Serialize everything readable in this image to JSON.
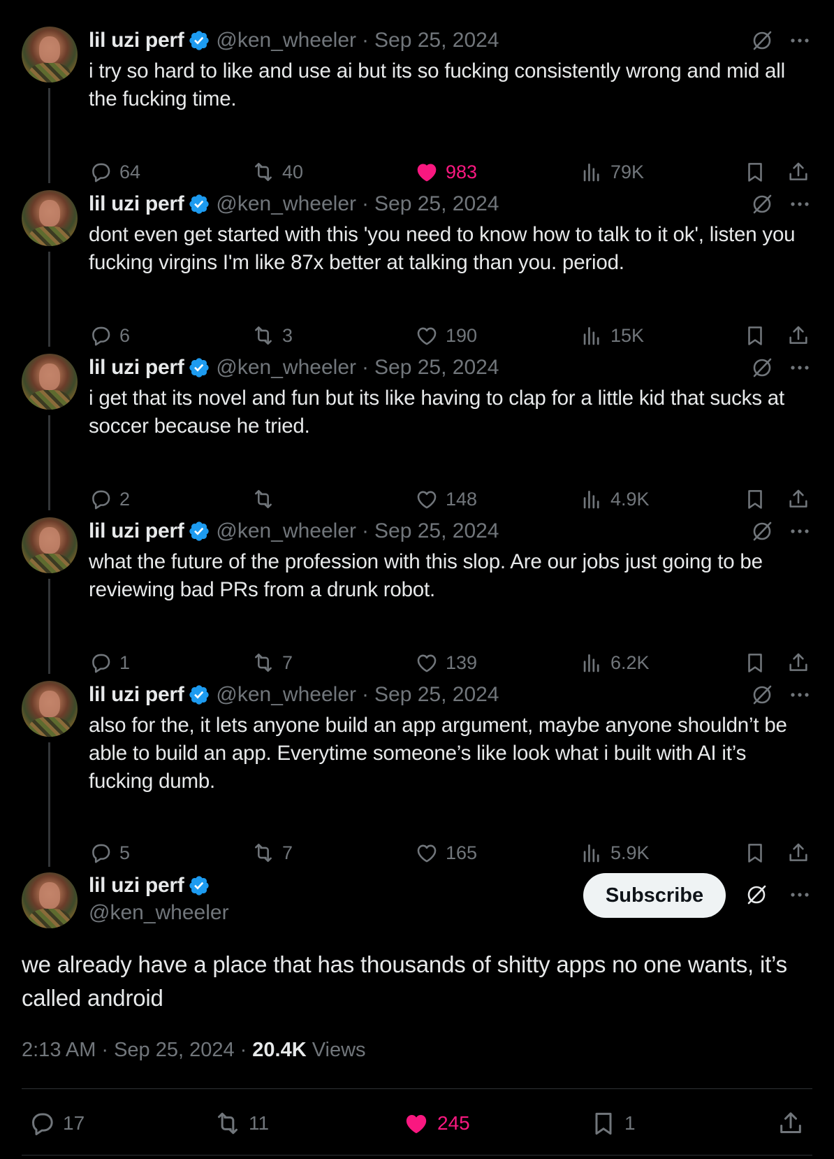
{
  "colors": {
    "background": "#000000",
    "text": "#e7e9ea",
    "muted": "#71767b",
    "verified": "#1d9bf0",
    "like": "#f91880"
  },
  "author": {
    "name": "lil uzi perf",
    "handle": "@ken_wheeler"
  },
  "thread": [
    {
      "name": "lil uzi perf",
      "handle": "@ken_wheeler",
      "sep": "·",
      "date": "Sep 25, 2024",
      "text": "i try so hard to like and use ai but its so fucking consistently wrong and mid all the fucking time.",
      "replies": "64",
      "reposts": "40",
      "likes": "983",
      "liked": true,
      "views": "79K"
    },
    {
      "name": "lil uzi perf",
      "handle": "@ken_wheeler",
      "sep": "·",
      "date": "Sep 25, 2024",
      "text": "dont even get started with this 'you need to know how to talk to it ok', listen you fucking virgins I'm like 87x better at talking than you. period.",
      "replies": "6",
      "reposts": "3",
      "likes": "190",
      "liked": false,
      "views": "15K"
    },
    {
      "name": "lil uzi perf",
      "handle": "@ken_wheeler",
      "sep": "·",
      "date": "Sep 25, 2024",
      "text": "i get that its novel and fun but its like having to clap for a little kid that sucks at soccer because he tried.",
      "replies": "2",
      "reposts": "",
      "likes": "148",
      "liked": false,
      "views": "4.9K"
    },
    {
      "name": "lil uzi perf",
      "handle": "@ken_wheeler",
      "sep": "·",
      "date": "Sep 25, 2024",
      "text": "what the future of the profession with this slop. Are our jobs just going to be reviewing bad PRs from a drunk robot.",
      "replies": "1",
      "reposts": "7",
      "likes": "139",
      "liked": false,
      "views": "6.2K"
    },
    {
      "name": "lil uzi perf",
      "handle": "@ken_wheeler",
      "sep": "·",
      "date": "Sep 25, 2024",
      "text": "also for the, it lets anyone build an app argument, maybe anyone shouldn’t be able to build an app. Everytime someone’s like look what i built with AI it’s fucking dumb.",
      "replies": "5",
      "reposts": "7",
      "likes": "165",
      "liked": false,
      "views": "5.9K"
    }
  ],
  "main": {
    "name": "lil uzi perf",
    "handle": "@ken_wheeler",
    "subscribe_label": "Subscribe",
    "text": "we already have a place that has thousands of shitty apps no one wants, it’s called android",
    "time": "2:13 AM",
    "sep": "·",
    "date": "Sep 25, 2024",
    "sep2": "·",
    "views_count": "20.4K",
    "views_label": "Views",
    "replies": "17",
    "reposts": "11",
    "likes": "245",
    "bookmarks": "1"
  },
  "icons": {
    "reply": "speech-bubble-icon",
    "repost": "repost-arrows-icon",
    "like": "heart-icon",
    "views": "bar-chart-icon",
    "bookmark": "bookmark-icon",
    "share": "share-upload-icon",
    "grok": "grok-slash-icon",
    "more": "more-dots-icon",
    "verified": "verified-badge-icon"
  }
}
